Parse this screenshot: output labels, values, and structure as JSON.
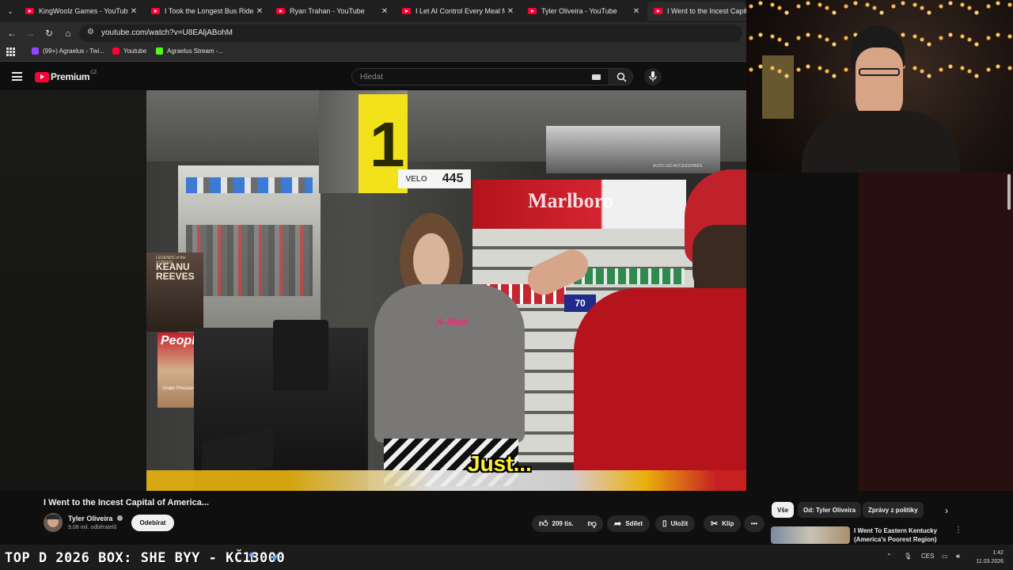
{
  "browser": {
    "tabs": [
      {
        "title": "KingWoolz Games - YouTube"
      },
      {
        "title": "I Took the Longest Bus Ride in"
      },
      {
        "title": "Ryan Trahan - YouTube"
      },
      {
        "title": "I Let AI Control Every Meal for"
      },
      {
        "title": "Tyler Oliveira - YouTube"
      },
      {
        "title": "I Went to the Incest Capital"
      }
    ],
    "url": "youtube.com/watch?v=U8EAljABohM",
    "bookmarks": [
      {
        "label": "(99+) Agraelus - Twi...",
        "color": "#9146ff"
      },
      {
        "label": "Youtube",
        "color": "#ff0033"
      },
      {
        "label": "Agraelus Stream -...",
        "color": "#53fc18"
      }
    ]
  },
  "youtube": {
    "logo_text": "Premium",
    "logo_region": "CZ",
    "search_placeholder": "Hledat"
  },
  "video": {
    "caption": "Just...",
    "sign_number": "1",
    "sign_price": "445",
    "sign_velo": "VELO",
    "sign_brand": "Marlboro",
    "magazine_title": "KEANU REEVES",
    "magazine_legends": "LEGENDS of the SCREEN",
    "magazine_people": "People",
    "magazine_under": "Under Pressure",
    "shirt_logo": "A-Med",
    "auto_led": "AUTO LED ACCESSORIES",
    "price_tag": "70"
  },
  "meta": {
    "title": "I Went to the Incest Capital of America...",
    "channel": "Tyler Oliveira",
    "subscribers": "9,08 mil. odběratelů",
    "subscribe_label": "Odebírat",
    "likes": "209 tis.",
    "share_label": "Sdílet",
    "save_label": "Uložit",
    "clip_label": "Klip"
  },
  "sidebar": {
    "chips": [
      "Vše",
      "Od: Tyler Oliveira",
      "Zprávy z politiky"
    ],
    "recommended_title_line1": "I Went To Eastern Kentucky",
    "recommended_title_line2": "(America's Poorest Region)"
  },
  "taskbar": {
    "ticker": "TOP D 2026 BOX: SHE  BYY - KČ13000",
    "language": "CES",
    "time": "1:42",
    "date": "11.03.2026"
  },
  "colors": {
    "yt_red": "#ff0033",
    "caption_yellow": "#ffef3a",
    "shirt_red": "#b5141c",
    "hat_red": "#c0222b"
  }
}
